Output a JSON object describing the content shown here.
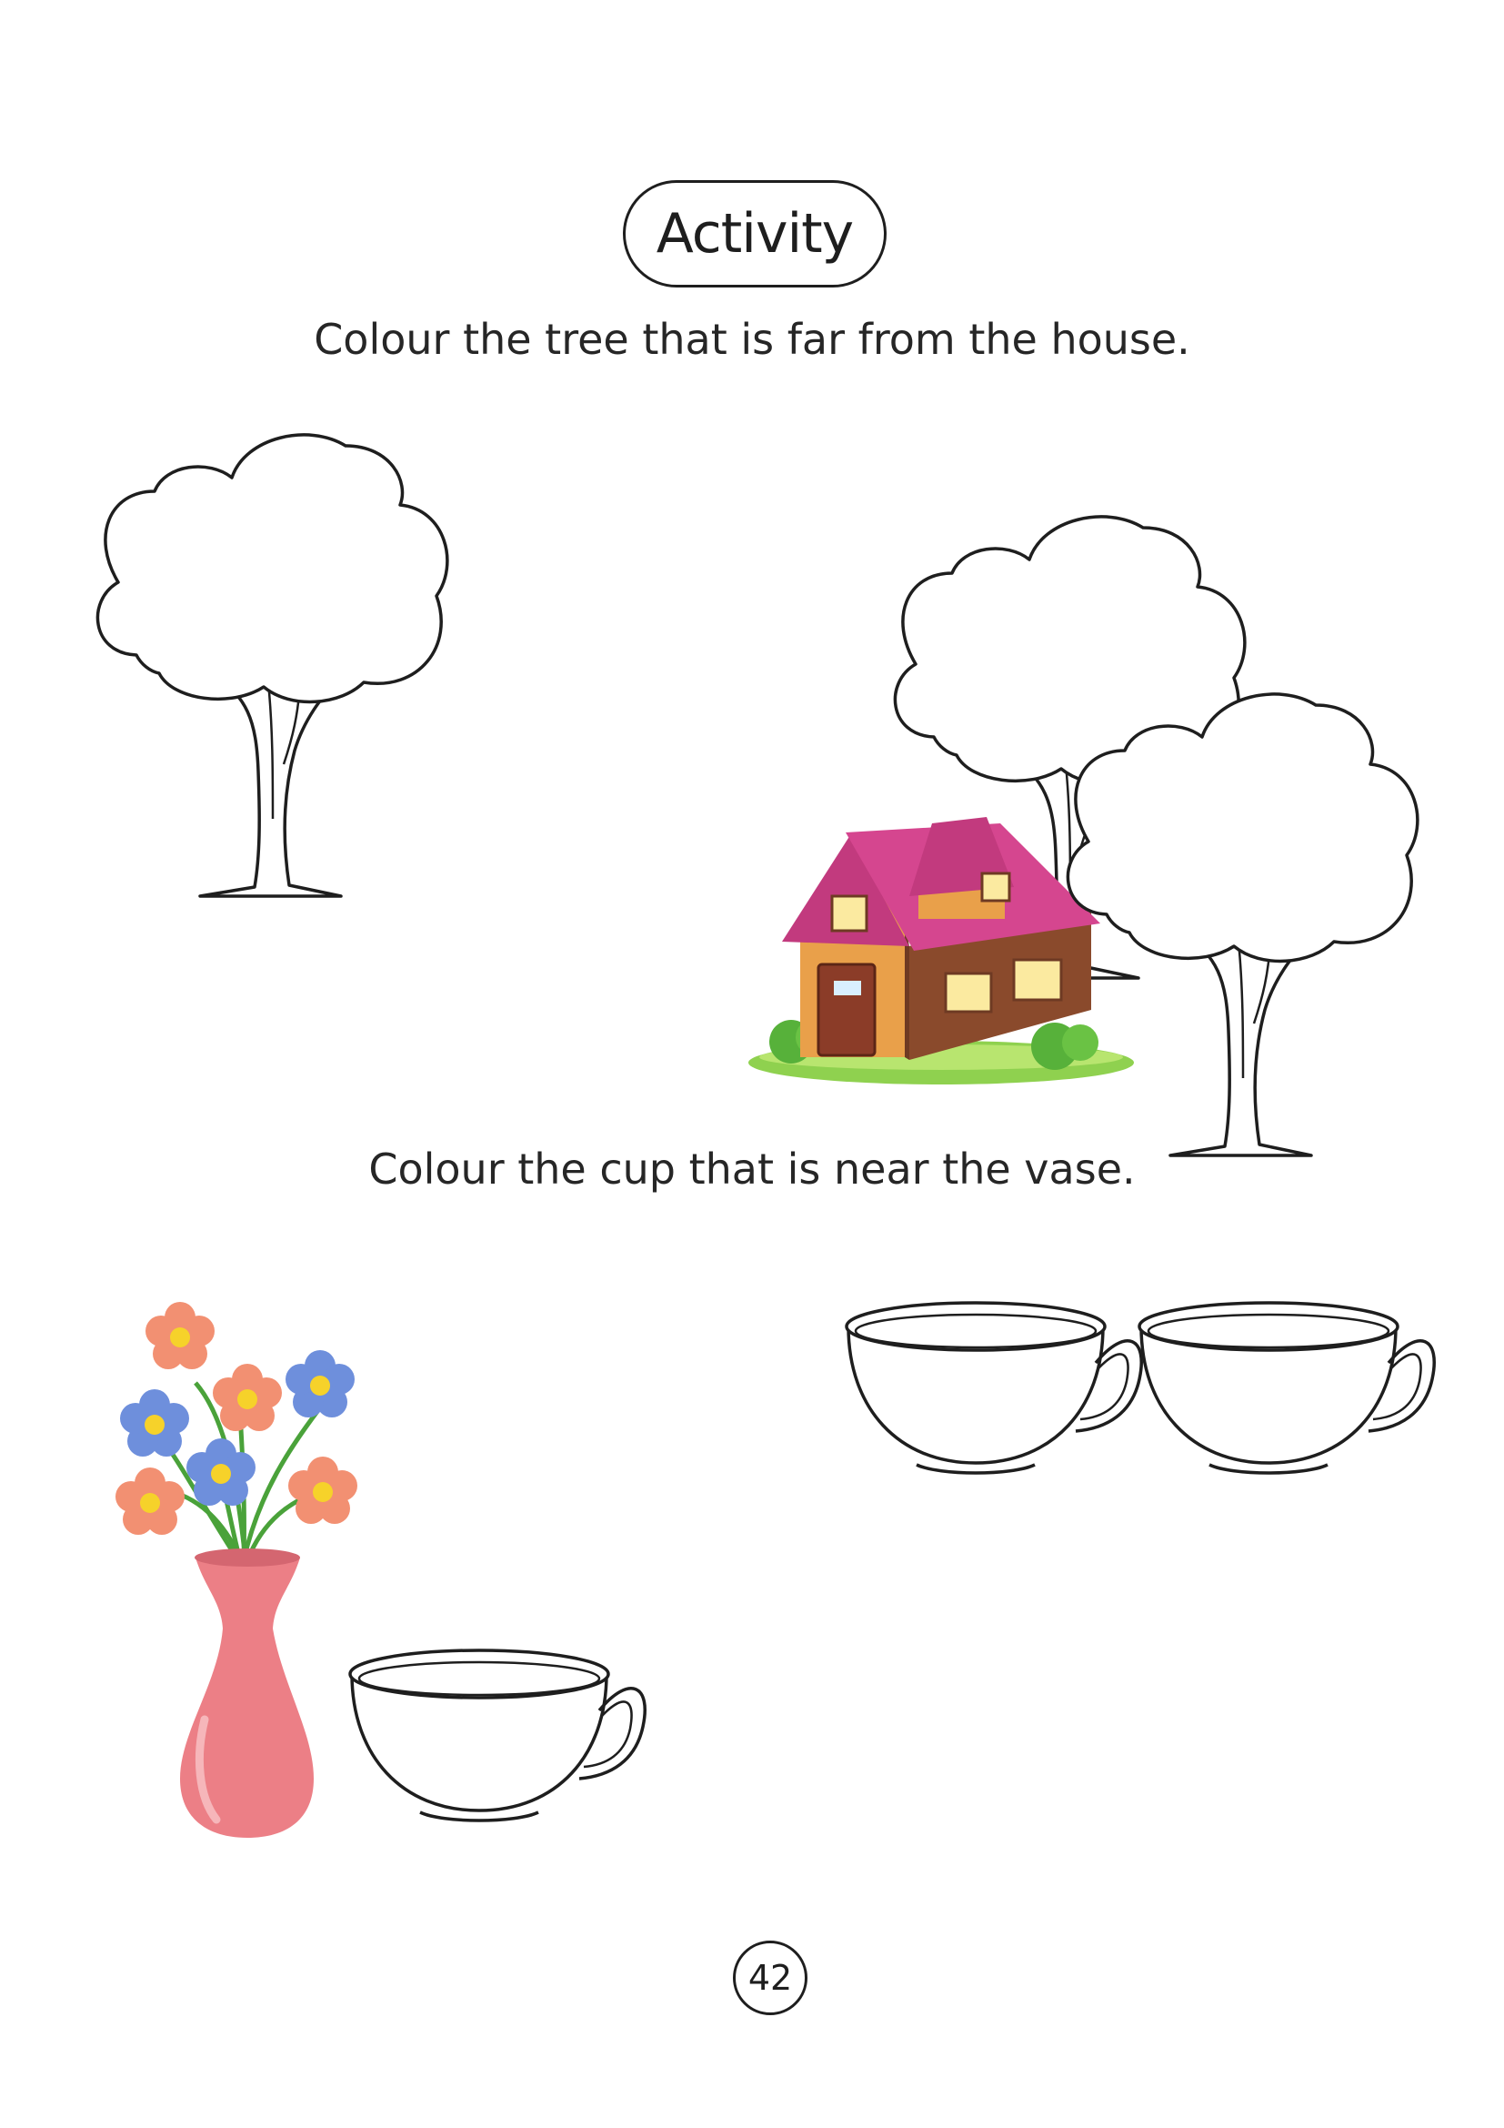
{
  "page": {
    "title": "Activity",
    "instruction_1": "Colour the tree that is far from the house.",
    "instruction_2": "Colour the cup that is near the vase.",
    "page_number": "42"
  },
  "illustrations": {
    "section_1": [
      "tree-icon",
      "tree-icon",
      "tree-icon",
      "house-icon"
    ],
    "section_2": [
      "vase-with-flowers-icon",
      "cup-icon",
      "cup-icon",
      "cup-icon"
    ]
  },
  "colors": {
    "ink": "#1e1e1e",
    "roof": "#d5468f",
    "house_wall": "#e9a04a",
    "house_side": "#8a4a2c",
    "grass": "#8fd14f",
    "vase": "#ec7f86",
    "flower_orange": "#f29072",
    "flower_blue": "#6e8fdc",
    "flower_center": "#f6d22a",
    "stem": "#4aa23a"
  }
}
